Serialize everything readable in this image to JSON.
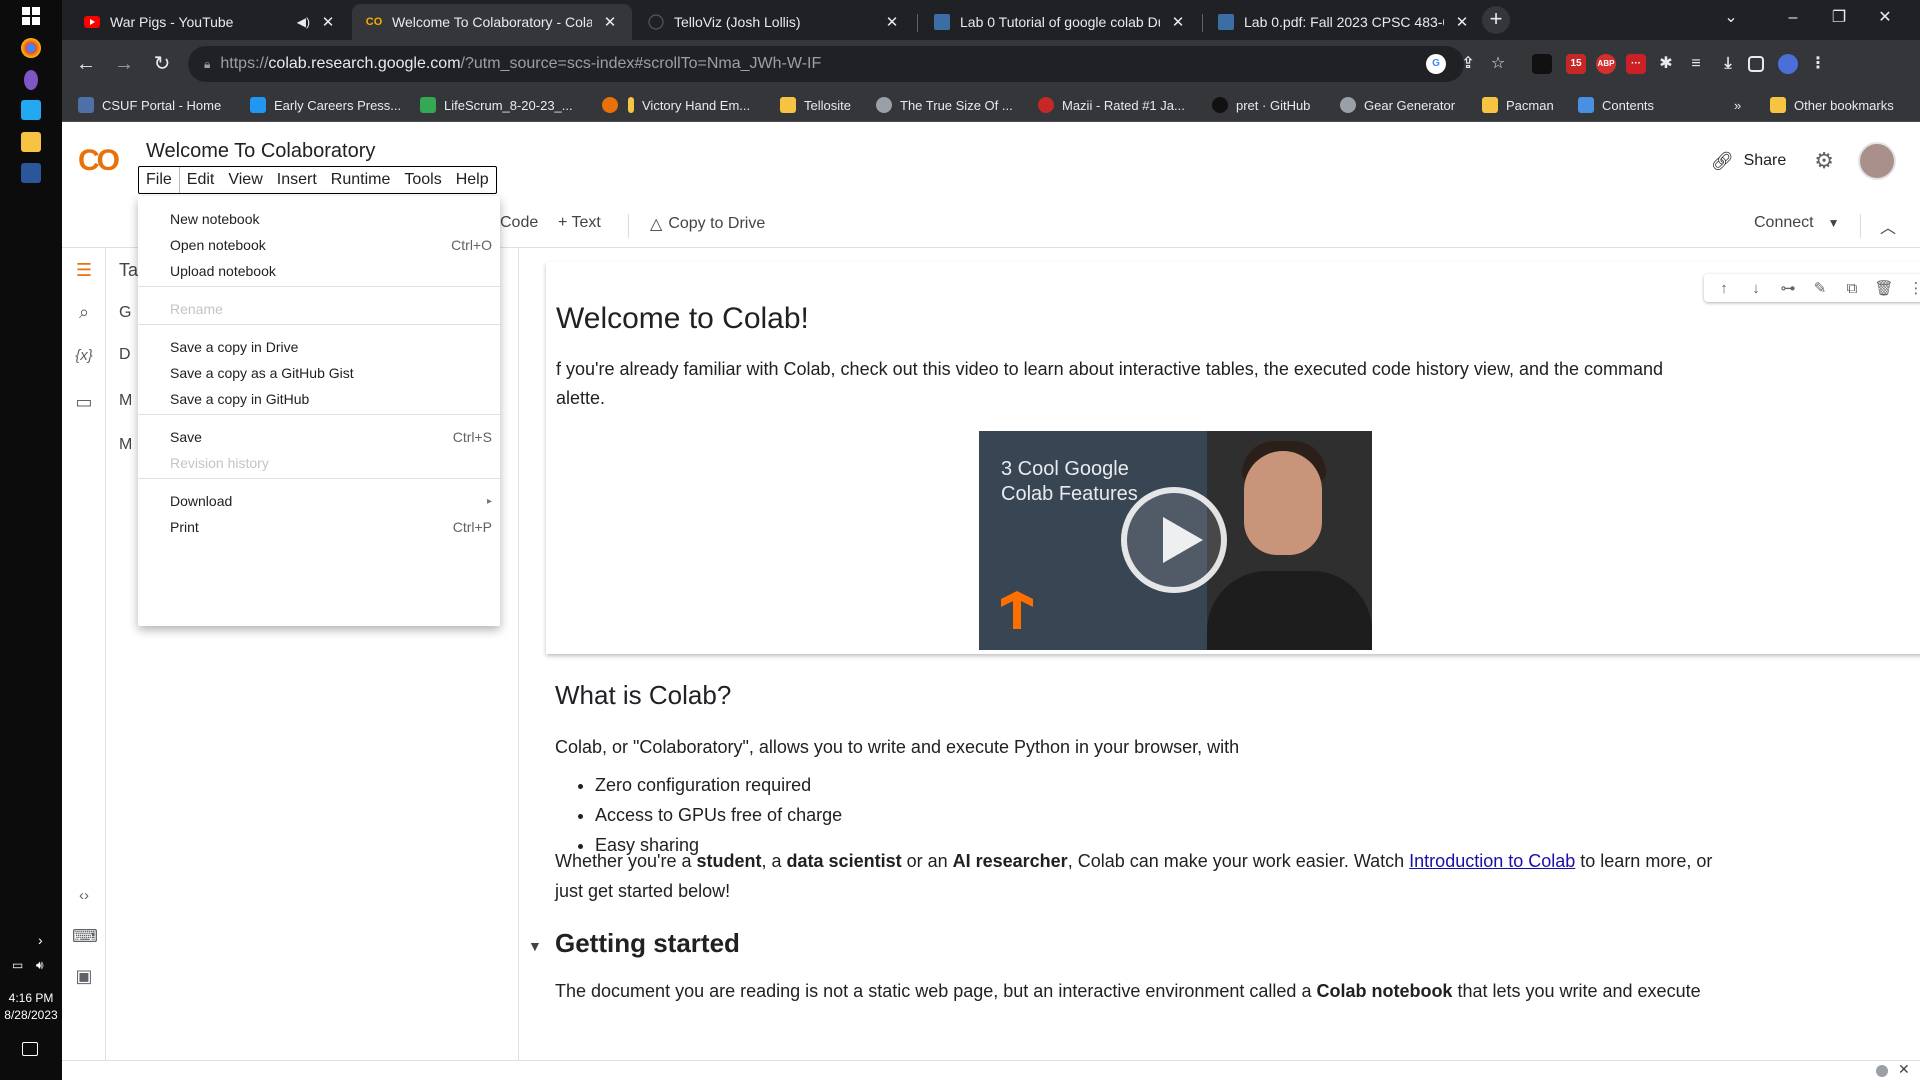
{
  "taskbar": {
    "time": "4:16 PM",
    "date": "8/28/2023"
  },
  "tabs": [
    {
      "title": "War Pigs - YouTube",
      "active": false
    },
    {
      "title": "Welcome To Colaboratory - Colal",
      "active": true
    },
    {
      "title": "TelloViz (Josh Lollis)",
      "active": false
    },
    {
      "title": "Lab 0 Tutorial of google colab Du",
      "active": false
    },
    {
      "title": "Lab 0.pdf: Fall 2023 CPSC 483-05",
      "active": false
    }
  ],
  "omnibox": {
    "scheme": "https://",
    "host": "colab.research.google.com",
    "path": "/?utm_source=scs-index#scrollTo=Nma_JWh-W-IF"
  },
  "extensions": {
    "badge_count": "15",
    "abp_label": "ABP"
  },
  "bookmarks": [
    {
      "label": "CSUF Portal - Home",
      "color": "#4f6fa8"
    },
    {
      "label": "Early Careers Press...",
      "color": "#2196f3"
    },
    {
      "label": "LifeScrum_8-20-23_...",
      "color": "#34a853"
    },
    {
      "label": "",
      "color": "#e8710a"
    },
    {
      "label": "Victory Hand Em...",
      "color": "#f6c343"
    },
    {
      "label": "Tellosite",
      "color": "#f6c343"
    },
    {
      "label": "The True Size Of ...",
      "color": "#9aa0a6"
    },
    {
      "label": "Mazii - Rated #1 Ja...",
      "color": "#c62828"
    },
    {
      "label": "pret · GitHub",
      "color": "#202124"
    },
    {
      "label": "Gear Generator",
      "color": "#9aa0a6"
    },
    {
      "label": "Pacman",
      "color": "#f6c343"
    },
    {
      "label": "Contents",
      "color": "#4a90e2"
    }
  ],
  "bookmarks_overflow": "»",
  "other_bookmarks": "Other bookmarks",
  "colab": {
    "logo": "CO",
    "title": "Welcome To Colaboratory",
    "menu": [
      "File",
      "Edit",
      "View",
      "Insert",
      "Runtime",
      "Tools",
      "Help"
    ],
    "share_label": "Share",
    "toolbar": {
      "code_label": "Code",
      "text_label": "+ Text",
      "copy_drive_label": "Copy to Drive",
      "connect_label": "Connect"
    },
    "toc_fragments": [
      "Tal",
      "G",
      "D",
      "M",
      "M"
    ]
  },
  "file_menu": {
    "items": [
      {
        "label": "New notebook",
        "shortcut": "",
        "disabled": false
      },
      {
        "label": "Open notebook",
        "shortcut": "Ctrl+O",
        "disabled": false
      },
      {
        "label": "Upload notebook",
        "shortcut": "",
        "disabled": false
      },
      {
        "label": "Rename",
        "shortcut": "",
        "disabled": true
      },
      {
        "label": "Save a copy in Drive",
        "shortcut": "",
        "disabled": false
      },
      {
        "label": "Save a copy as a GitHub Gist",
        "shortcut": "",
        "disabled": false
      },
      {
        "label": "Save a copy in GitHub",
        "shortcut": "",
        "disabled": false
      },
      {
        "label": "Save",
        "shortcut": "Ctrl+S",
        "disabled": false
      },
      {
        "label": "Revision history",
        "shortcut": "",
        "disabled": true
      },
      {
        "label": "Download",
        "shortcut": "▸",
        "disabled": false
      },
      {
        "label": "Print",
        "shortcut": "Ctrl+P",
        "disabled": false
      }
    ]
  },
  "notebook": {
    "h1": "Welcome to Colab!",
    "intro": "f you're already familiar with Colab, check out this video to learn about interactive tables, the executed code history view, and the command",
    "intro_line2": "alette.",
    "video_title_1": "3 Cool Google",
    "video_title_2": "Colab Features",
    "h2_what": "What is Colab?",
    "what_p": "Colab, or \"Colaboratory\", allows you to write and execute Python in your browser, with",
    "bullets": [
      "Zero configuration required",
      "Access to GPUs free of charge",
      "Easy sharing"
    ],
    "whether_1": "Whether you're a ",
    "student": "student",
    "whether_2": ", a ",
    "data_scientist": "data scientist",
    "whether_3": " or an ",
    "ai_researcher": "AI researcher",
    "whether_4": ", Colab can make your work easier. Watch ",
    "intro_link": "Introduction to Colab",
    "whether_5": " to learn more, or",
    "whether_line2": "just get started below!",
    "h2_getting": "Getting started",
    "doc_p_1": "The document you are reading is not a static web page, but an interactive environment called a ",
    "colab_notebook": "Colab notebook",
    "doc_p_2": " that lets you write and execute"
  },
  "colors": {
    "tab_active": "#35363a",
    "tab_strip": "#202124",
    "colab_orange": "#f9ab00",
    "link": "#1a0dab"
  }
}
